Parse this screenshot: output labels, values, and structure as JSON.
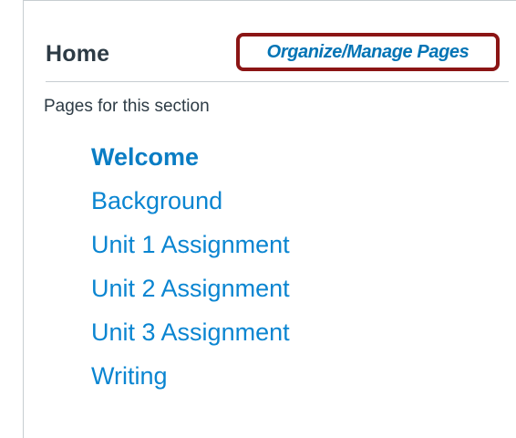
{
  "header": {
    "title": "Home",
    "organize_link": "Organize/Manage Pages"
  },
  "section": {
    "label": "Pages for this section"
  },
  "pages": [
    {
      "label": "Welcome",
      "current": true
    },
    {
      "label": "Background",
      "current": false
    },
    {
      "label": "Unit 1 Assignment",
      "current": false
    },
    {
      "label": "Unit 2 Assignment",
      "current": false
    },
    {
      "label": "Unit 3 Assignment",
      "current": false
    },
    {
      "label": "Writing",
      "current": false
    }
  ],
  "colors": {
    "link": "#0a85d1",
    "text": "#2d3b45",
    "highlight_border": "#8b1515",
    "divider": "#c7cdd1"
  }
}
